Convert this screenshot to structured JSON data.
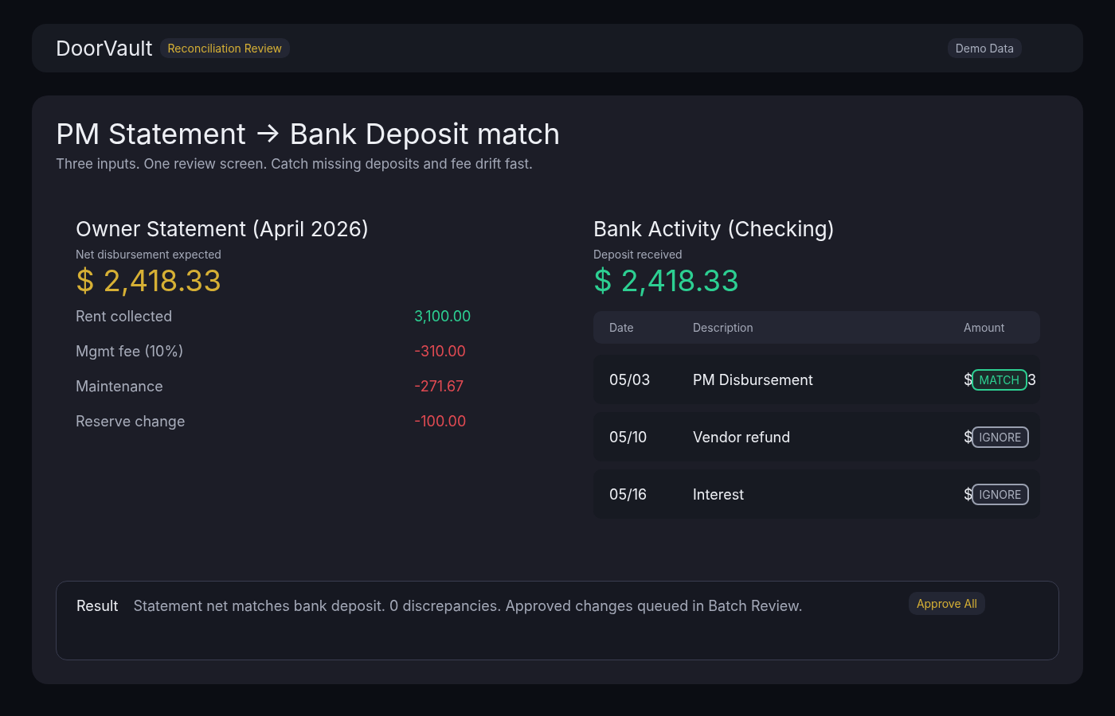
{
  "header": {
    "brand": "DoorVault",
    "tag": "Reconciliation Review",
    "demo_badge": "Demo Data"
  },
  "page": {
    "title": "PM Statement → Bank Deposit match",
    "subtitle": "Three inputs. One review screen. Catch missing deposits and fee drift fast."
  },
  "owner_statement": {
    "title": "Owner Statement (April 2026)",
    "caption": "Net disbursement expected",
    "total": "$ 2,418.33",
    "lines": [
      {
        "label": "Rent collected",
        "amount": "3,100.00",
        "kind": "credit"
      },
      {
        "label": "Mgmt fee (10%)",
        "amount": "-310.00",
        "kind": "debit"
      },
      {
        "label": "Maintenance",
        "amount": "-271.67",
        "kind": "debit"
      },
      {
        "label": "Reserve change",
        "amount": "-100.00",
        "kind": "debit"
      }
    ]
  },
  "bank_activity": {
    "title": "Bank Activity (Checking)",
    "caption": "Deposit received",
    "total": "$ 2,418.33",
    "columns": [
      "Date",
      "Description",
      "Amount"
    ],
    "rows": [
      {
        "date": "05/03",
        "description": "PM Disbursement",
        "amount_start": "$",
        "status": {
          "kind": "match",
          "label": "MATCH"
        },
        "amount_end": "3"
      },
      {
        "date": "05/10",
        "description": "Vendor refund",
        "amount_start": "$",
        "status": {
          "kind": "ignore",
          "label": "IGNORE"
        }
      },
      {
        "date": "05/16",
        "description": "Interest",
        "amount_start": "$",
        "status": {
          "kind": "ignore",
          "label": "IGNORE"
        }
      }
    ]
  },
  "result": {
    "label": "Result",
    "message": "Statement net matches bank deposit. 0 discrepancies. Approved changes queued in Batch Review.",
    "button": "Approve All"
  }
}
